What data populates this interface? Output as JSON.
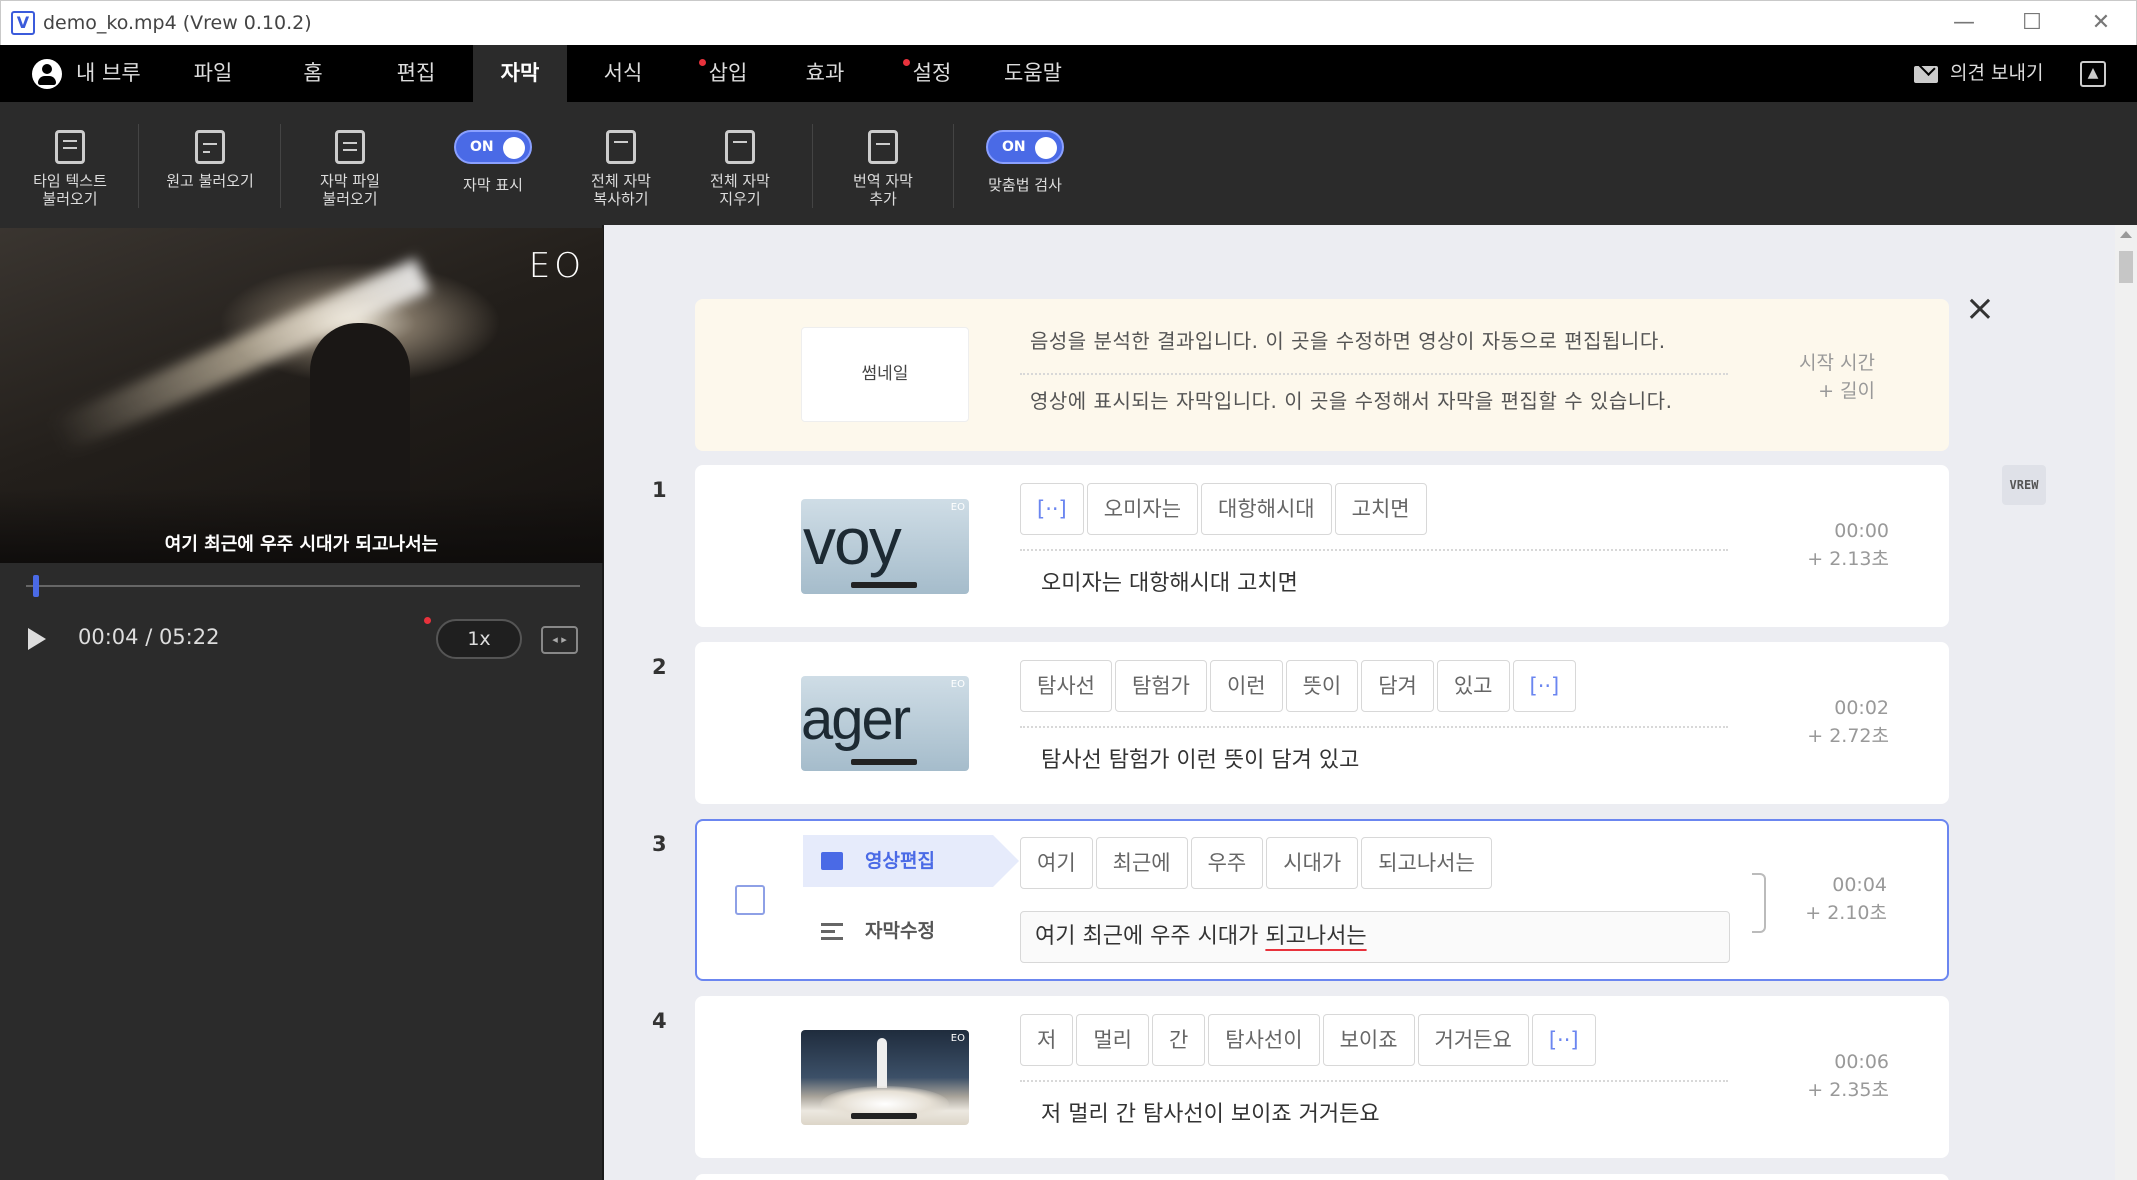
{
  "window": {
    "title": "demo_ko.mp4 (Vrew 0.10.2)",
    "app_icon": "V",
    "minimize": "—",
    "maximize": "☐",
    "close": "✕"
  },
  "menu": {
    "user_label": "내 브루",
    "items": [
      {
        "label": "파일",
        "dot": false
      },
      {
        "label": "홈",
        "dot": false
      },
      {
        "label": "편집",
        "dot": false
      },
      {
        "label": "자막",
        "dot": false,
        "active": true
      },
      {
        "label": "서식",
        "dot": false
      },
      {
        "label": "삽입",
        "dot": true
      },
      {
        "label": "효과",
        "dot": false
      },
      {
        "label": "설정",
        "dot": true
      },
      {
        "label": "도움말",
        "dot": false
      }
    ],
    "feedback_label": "의견 보내기",
    "up_icon": "▲"
  },
  "toolbar": {
    "timed_text_1": "타임 텍스트",
    "timed_text_2": "불러오기",
    "script_import": "원고 불러오기",
    "subtitle_file_1": "자막 파일",
    "subtitle_file_2": "불러오기",
    "show_subtitles": "자막 표시",
    "show_subtitles_state": "ON",
    "copy_all_1": "전체 자막",
    "copy_all_2": "복사하기",
    "delete_all_1": "전체 자막",
    "delete_all_2": "지우기",
    "translate_1": "번역 자막",
    "translate_2": "추가",
    "spellcheck": "맞춤법 검사",
    "spellcheck_state": "ON"
  },
  "player": {
    "watermark": "EO",
    "caption": "여기 최근에 우주 시대가 되고나서는",
    "time": "00:04 / 05:22",
    "speed": "1x",
    "playhead_fraction": 0.0125
  },
  "editor": {
    "header": {
      "thumbnail_label": "썸네일",
      "line1": "음성을 분석한 결과입니다. 이 곳을 수정하면 영상이 자동으로 편집됩니다.",
      "line2": "영상에 표시되는 자막입니다. 이 곳을 수정해서 자막을 편집할 수 있습니다.",
      "start_label": "시작 시간",
      "length_label": "+ 길이"
    },
    "close_icon": "×",
    "vrew_badge": "VREW",
    "rows": [
      {
        "num": "1",
        "thumb_text": "voy",
        "words": [
          "[··]",
          "오미자는",
          "대항해시대",
          "고치면"
        ],
        "subtitle": "오미자는 대항해시대 고치면",
        "start": "00:00",
        "length": "+  2.13초"
      },
      {
        "num": "2",
        "thumb_text": "ager",
        "words": [
          "탐사선",
          "탐험가",
          "이런",
          "뜻이",
          "담겨",
          "있고",
          "[··]"
        ],
        "subtitle": "탐사선 탐험가 이런 뜻이 담겨 있고",
        "start": "00:02",
        "length": "+  2.72초"
      },
      {
        "num": "3",
        "words": [
          "여기",
          "최근에",
          "우주",
          "시대가",
          "되고나서는"
        ],
        "subtitle_plain": "여기 최근에 우주 시대가 ",
        "subtitle_error": "되고나서는",
        "start": "00:04",
        "length": "+  2.10초",
        "mode_video": "영상편집",
        "mode_subtitle": "자막수정"
      },
      {
        "num": "4",
        "words": [
          "저",
          "멀리",
          "간",
          "탐사선이",
          "보이죠",
          "거거든요",
          "[··]"
        ],
        "subtitle": "저 멀리 간 탐사선이 보이죠 거거든요",
        "start": "00:06",
        "length": "+  2.35초"
      }
    ]
  }
}
